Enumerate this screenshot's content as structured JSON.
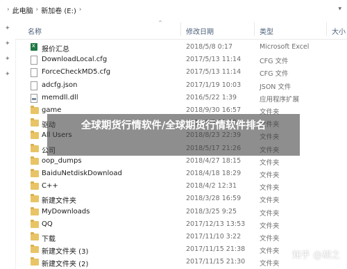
{
  "breadcrumb": {
    "items": [
      "此电脑",
      "新加卷 (E:)"
    ]
  },
  "columns": {
    "name": "名称",
    "modified": "修改日期",
    "type": "类型",
    "size": "大小"
  },
  "files": [
    {
      "name": "报价汇总",
      "date": "2018/5/8 0:17",
      "type": "Microsoft Excel",
      "icon": "excel-icon"
    },
    {
      "name": "DownloadLocal.cfg",
      "date": "2017/5/13 11:14",
      "type": "CFG 文件",
      "icon": "file-icon"
    },
    {
      "name": "ForceCheckMD5.cfg",
      "date": "2017/5/13 11:14",
      "type": "CFG 文件",
      "icon": "file-icon"
    },
    {
      "name": "adcfg.json",
      "date": "2017/1/19 10:03",
      "type": "JSON 文件",
      "icon": "file-icon"
    },
    {
      "name": "memdll.dll",
      "date": "2016/5/22 1:39",
      "type": "应用程序扩展",
      "icon": "dll-icon"
    },
    {
      "name": "game",
      "date": "2018/9/30 16:57",
      "type": "文件夹",
      "icon": "folder-icon"
    },
    {
      "name": "驱动",
      "date": "2018/9/3 11:19",
      "type": "文件夹",
      "icon": "folder-icon"
    },
    {
      "name": "All Users",
      "date": "2018/8/23 22:39",
      "type": "文件夹",
      "icon": "folder-icon"
    },
    {
      "name": "公司",
      "date": "2018/5/17 21:26",
      "type": "文件夹",
      "icon": "folder-icon"
    },
    {
      "name": "oop_dumps",
      "date": "2018/4/27 18:15",
      "type": "文件夹",
      "icon": "folder-icon"
    },
    {
      "name": "BaiduNetdiskDownload",
      "date": "2018/4/18 18:29",
      "type": "文件夹",
      "icon": "folder-icon"
    },
    {
      "name": "C++",
      "date": "2018/4/2 12:31",
      "type": "文件夹",
      "icon": "folder-icon"
    },
    {
      "name": "新建文件夹",
      "date": "2018/3/28 16:59",
      "type": "文件夹",
      "icon": "folder-icon"
    },
    {
      "name": "MyDownloads",
      "date": "2018/3/25 9:25",
      "type": "文件夹",
      "icon": "folder-icon"
    },
    {
      "name": "QQ",
      "date": "2017/12/13 13:53",
      "type": "文件夹",
      "icon": "folder-icon"
    },
    {
      "name": "下载",
      "date": "2017/11/10 3:22",
      "type": "文件夹",
      "icon": "folder-icon"
    },
    {
      "name": "新建文件夹 (3)",
      "date": "2017/11/15 21:38",
      "type": "文件夹",
      "icon": "folder-icon"
    },
    {
      "name": "新建文件夹 (2)",
      "date": "2017/11/15 21:30",
      "type": "文件夹",
      "icon": "folder-icon"
    }
  ],
  "banner": {
    "text": "全球期货行情软件/全球期货行情软件排名"
  },
  "watermark": {
    "text": "知乎 @胡之"
  },
  "colors": {
    "folder": "#e8c466",
    "header_text": "#4c607a",
    "excel": "#1f7a44"
  }
}
